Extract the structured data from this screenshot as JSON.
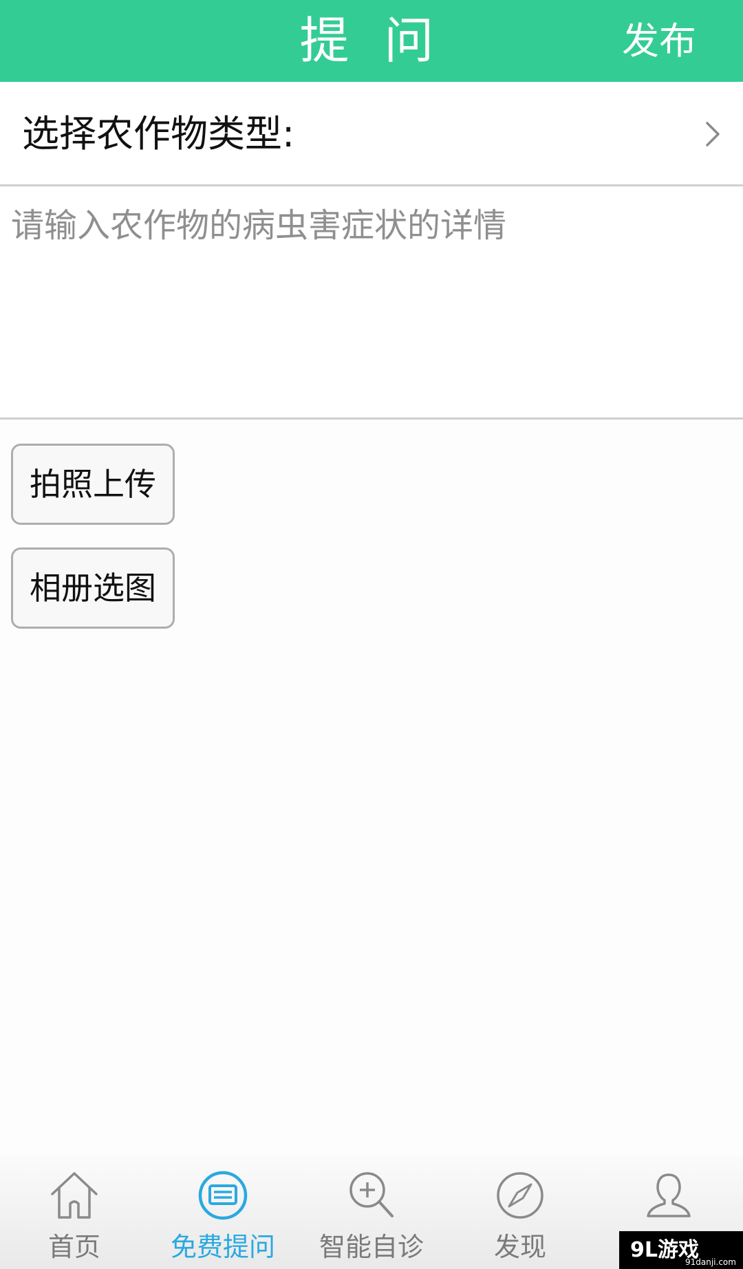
{
  "header": {
    "title": "提 问",
    "action_label": "发布"
  },
  "crop_selector": {
    "label": "选择农作物类型:",
    "icon": "chevron-right-icon"
  },
  "detail_input": {
    "placeholder": "请输入农作物的病虫害症状的详情",
    "value": ""
  },
  "buttons": {
    "take_photo": "拍照上传",
    "choose_album": "相册选图"
  },
  "tabbar": {
    "items": [
      {
        "label": "首页",
        "icon": "home-icon",
        "active": false
      },
      {
        "label": "免费提问",
        "icon": "chat-icon",
        "active": true
      },
      {
        "label": "智能自诊",
        "icon": "zoom-plus-icon",
        "active": false
      },
      {
        "label": "发现",
        "icon": "compass-icon",
        "active": false
      },
      {
        "label": "",
        "icon": "user-icon",
        "active": false
      }
    ]
  },
  "watermark": {
    "brand": "9L游戏",
    "site": "91danji.com"
  },
  "colors": {
    "header_bg": "#34cc95",
    "active_tab": "#2aa9e0",
    "inactive_tab": "#7a7a7a"
  }
}
